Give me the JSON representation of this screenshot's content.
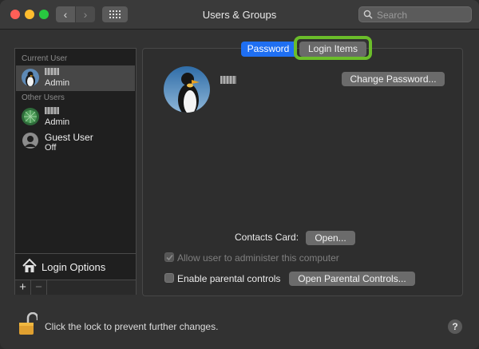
{
  "window": {
    "title": "Users & Groups"
  },
  "toolbar": {
    "search_placeholder": "Search",
    "icons": [
      "chevron-left-icon",
      "chevron-right-icon",
      "grid-icon",
      "search-icon"
    ]
  },
  "sidebar": {
    "current_user_label": "Current User",
    "current_user_role": "Admin",
    "other_users_label": "Other Users",
    "other_user_role": "Admin",
    "guest_name": "Guest User",
    "guest_status": "Off",
    "login_options_label": "Login Options",
    "add_label": "+",
    "remove_label": "−"
  },
  "tabs": [
    {
      "label": "Password",
      "selected": true
    },
    {
      "label": "Login Items",
      "selected": false
    }
  ],
  "main": {
    "change_password_label": "Change Password...",
    "contacts_card_label": "Contacts Card:",
    "open_label": "Open...",
    "allow_admin_label": "Allow user to administer this computer",
    "allow_admin_checked": true,
    "allow_admin_enabled": false,
    "parental_controls_label": "Enable parental controls",
    "parental_controls_checked": false,
    "open_parental_label": "Open Parental Controls..."
  },
  "footer": {
    "lock_text": "Click the lock to prevent further changes.",
    "help_label": "?"
  },
  "colors": {
    "highlight": "#6bbd2a",
    "accent": "#1f6ff2"
  }
}
